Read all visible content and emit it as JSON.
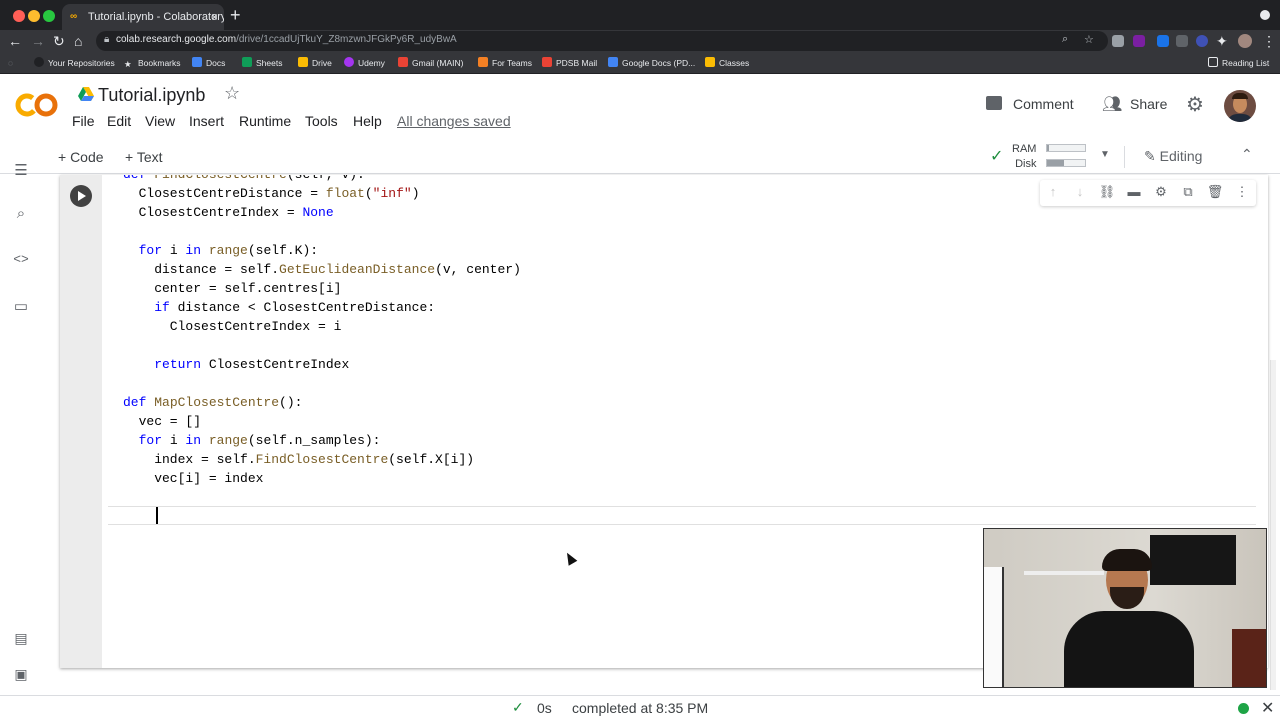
{
  "browser": {
    "tab_title": "Tutorial.ipynb - Colaboratory",
    "tab_close": "×",
    "new_tab": "+",
    "url_main": "colab.research.google.com",
    "url_rest": "/drive/1ccadUjTkuY_Z8mzwnJFGkPy6R_udyBwA",
    "bookmarks": [
      "Your Repositories",
      "Bookmarks",
      "Docs",
      "Sheets",
      "Drive",
      "Udemy",
      "Gmail (MAIN)",
      "For Teams",
      "PDSB Mail",
      "Google Docs (PD...",
      "Classes"
    ],
    "reading_list": "Reading List"
  },
  "header": {
    "logo_text": "CO",
    "title": "Tutorial.ipynb",
    "menu": [
      "File",
      "Edit",
      "View",
      "Insert",
      "Runtime",
      "Tools",
      "Help"
    ],
    "saved_status": "All changes saved",
    "comment_label": "Comment",
    "share_label": "Share"
  },
  "toolbar": {
    "add_code": "+ Code",
    "add_text": "+ Text",
    "ram_label": "RAM",
    "disk_label": "Disk",
    "ram_usage": 0.05,
    "disk_usage": 0.45,
    "editing_label": "Editing"
  },
  "code_lines": [
    "def FindClosestCentre(self, v):",
    "  ClosestCentreDistance = float(\"inf\")",
    "  ClosestCentreIndex = None",
    "",
    "  for i in range(self.K):",
    "    distance = self.GetEuclideanDistance(v, center)",
    "    center = self.centres[i]",
    "    if distance < ClosestCentreDistance:",
    "      ClosestCentreIndex = i",
    "",
    "    return ClosestCentreIndex",
    "",
    "def MapClosestCentre():",
    "  vec = []",
    "  for i in range(self.n_samples):",
    "    index = self.FindClosestCentre(self.X[i])",
    "    vec[i] = index"
  ],
  "status": {
    "duration": "0s",
    "completed": "completed at 8:35 PM"
  }
}
